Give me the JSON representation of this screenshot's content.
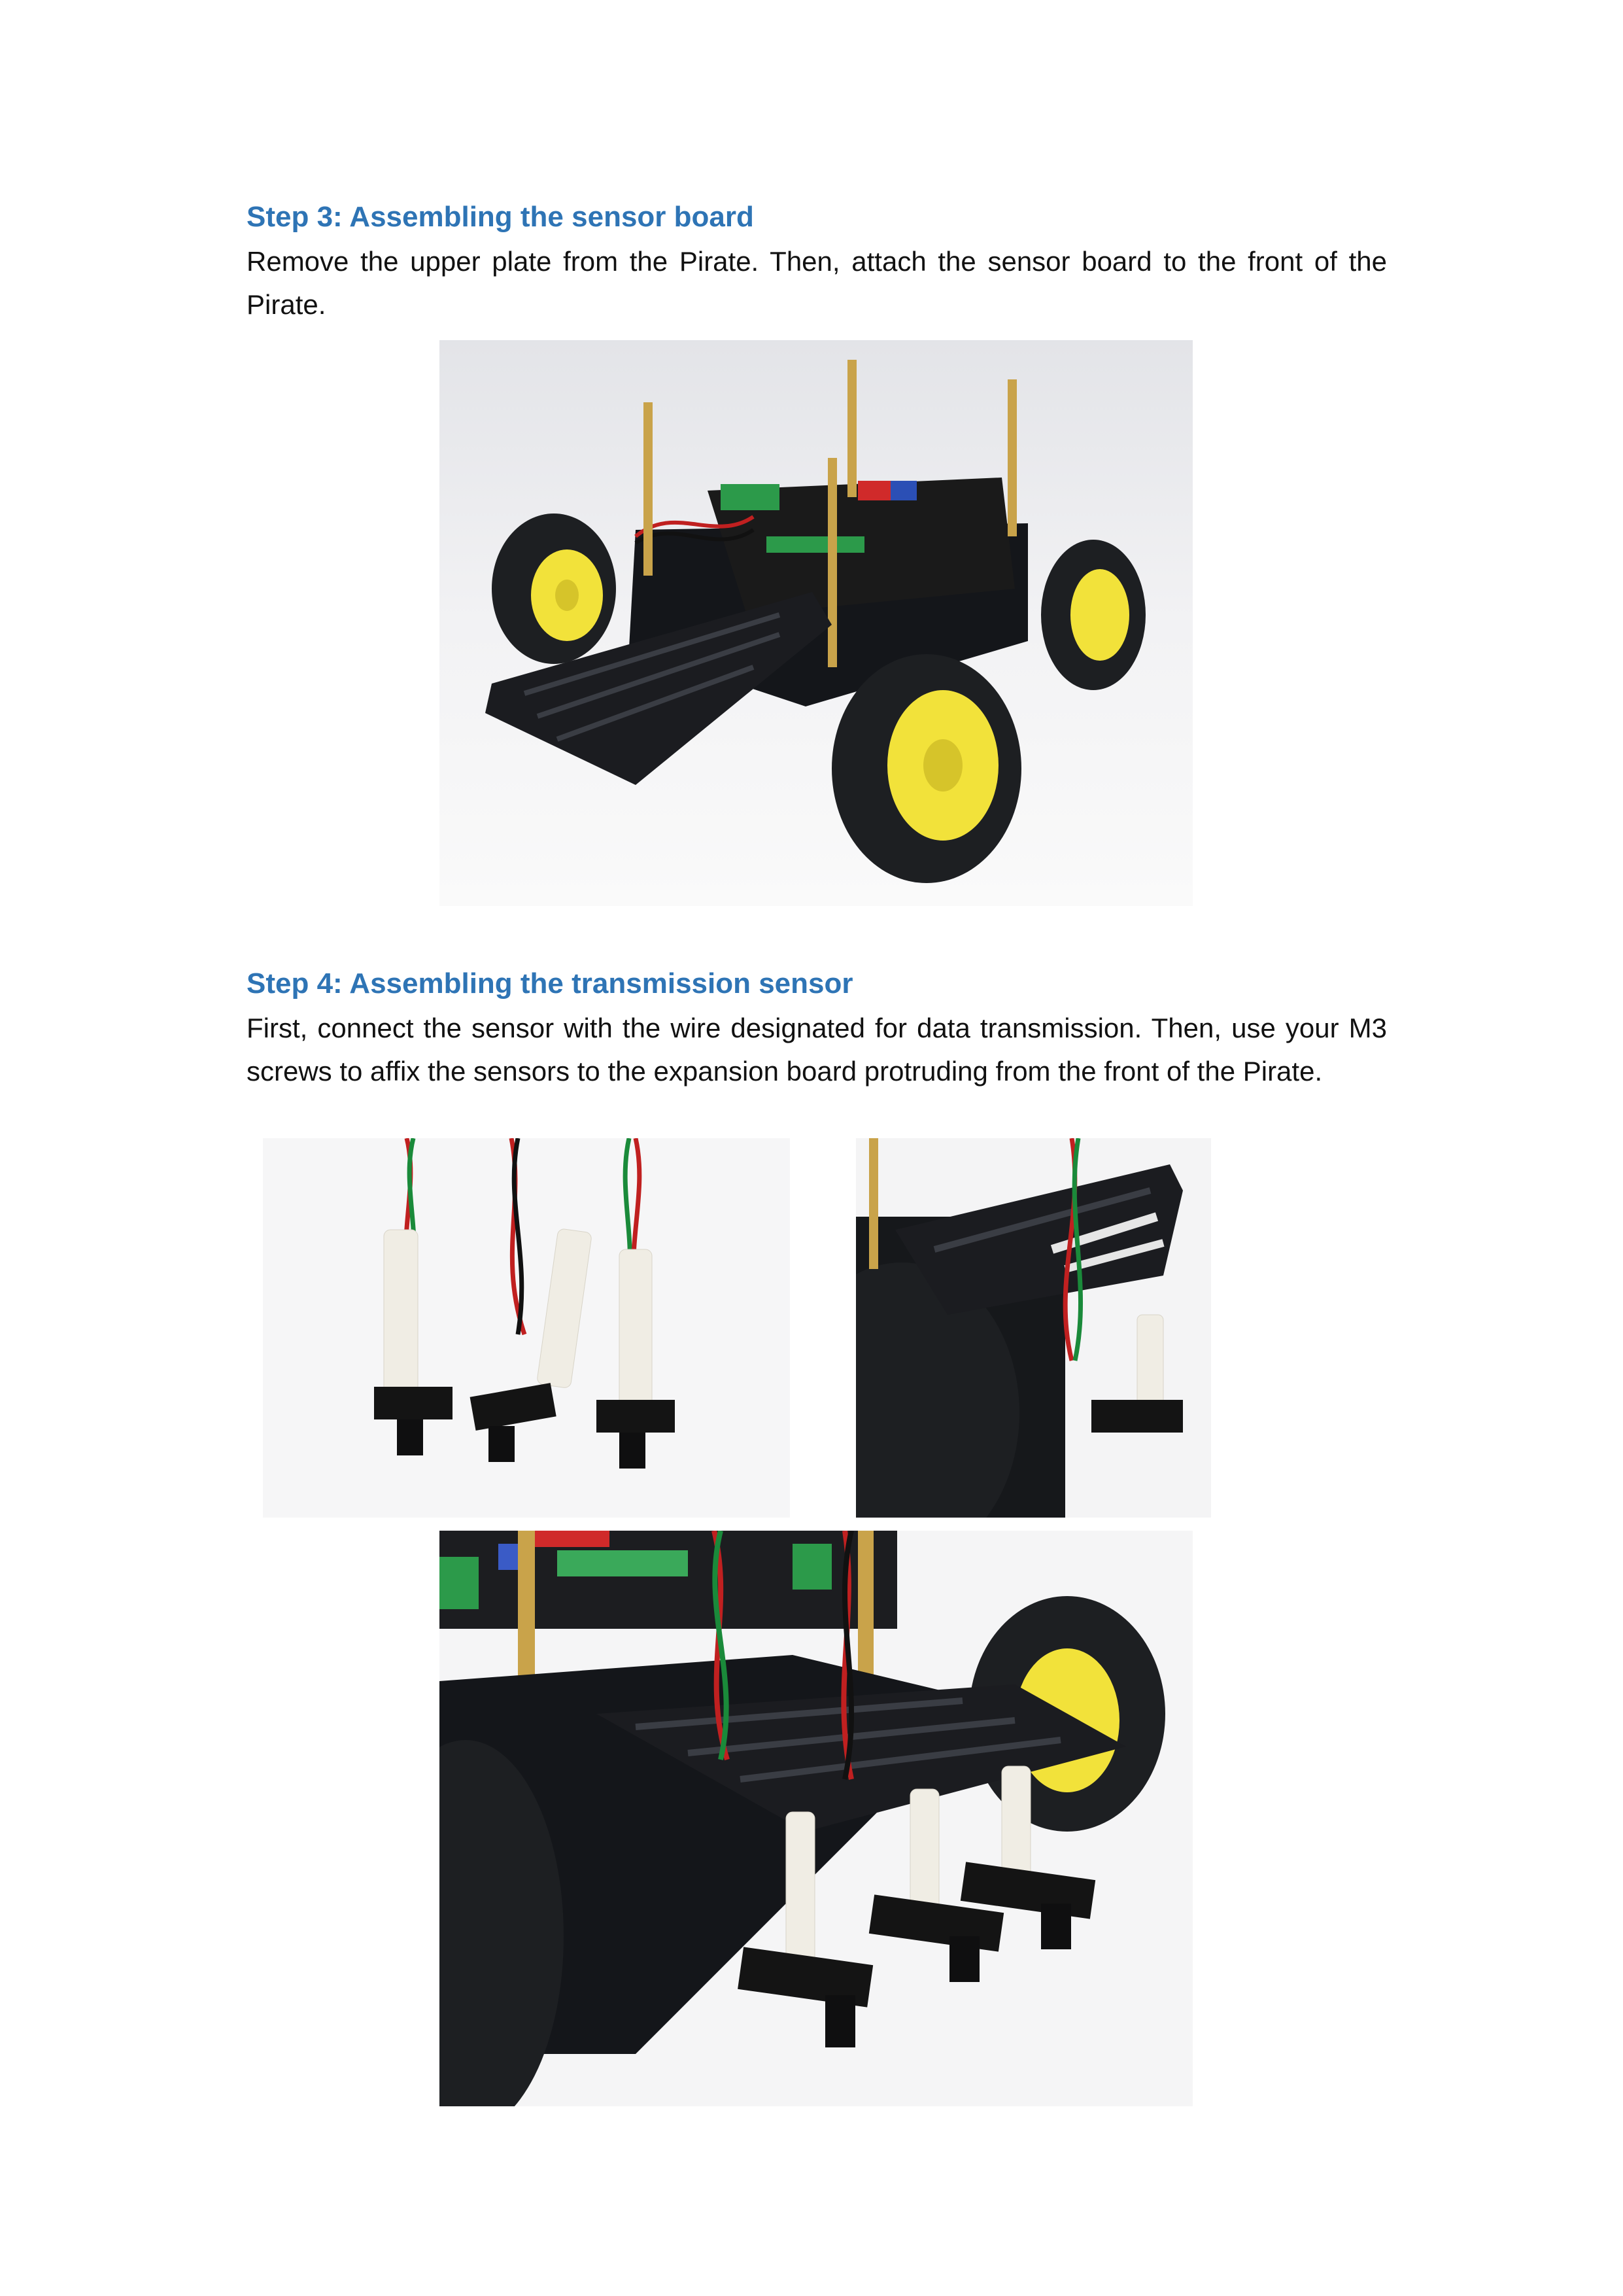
{
  "step3": {
    "heading": "Step 3: Assembling the sensor board",
    "body": "Remove the upper plate from the Pirate. Then, attach the sensor board to the front of the Pirate."
  },
  "step4": {
    "heading": "Step 4: Assembling the transmission sensor",
    "body": "First, connect the sensor with the wire designated for data transmission. Then, use your M3 screws to affix the sensors to the expansion board protruding from the front of the Pirate."
  },
  "colors": {
    "heading": "#2e74b5",
    "text": "#111111",
    "chassis": "#14161a",
    "tire": "#1d1f22",
    "hub": "#f2e23a",
    "pcb": "#1a1a1a",
    "brass": "#c9a34a"
  }
}
